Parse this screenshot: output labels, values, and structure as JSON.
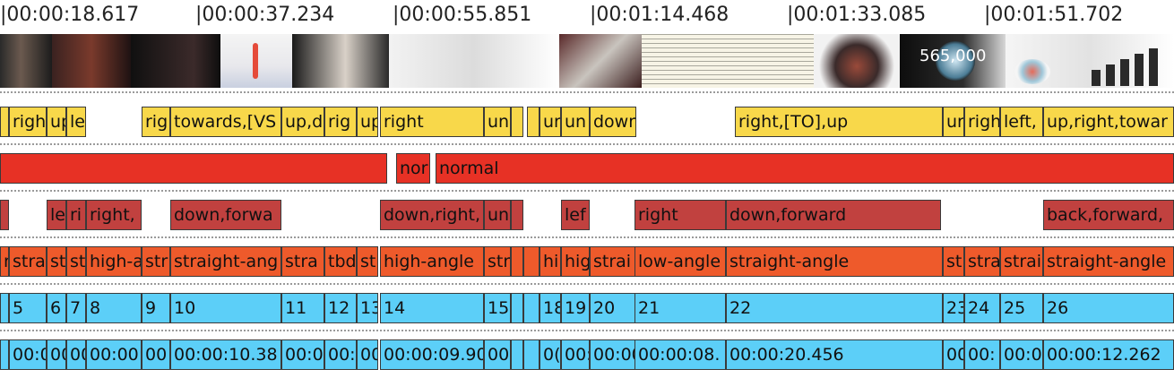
{
  "ruler": {
    "ticks": [
      "|00:00:18.617",
      "|00:00:37.234",
      "|00:00:55.851",
      "|00:01:14.468",
      "|00:01:33.085",
      "|00:01:51.702"
    ]
  },
  "thumbnails": {
    "overlay_text": "565,000",
    "frames": [
      "man-speaking-closeup",
      "audience-in-dark-room",
      "thermometer-graphic",
      "speaker-at-podium",
      "united-nations-document",
      "crowd-photo",
      "newspaper-article",
      "dark-sphere-texture",
      "globe-number-565000",
      "blue-earth-icon",
      "co2-bar-chart"
    ]
  },
  "tracks": [
    {
      "id": "direction",
      "color": "#f8d84a",
      "clips": [
        "",
        "righ",
        "up",
        "le",
        "rig",
        "towards,[VS",
        "up,d",
        "rig",
        "up",
        "right",
        "un",
        "",
        "",
        "ur",
        "un",
        "down",
        "right,[TO],up",
        "ur",
        "righ",
        "left,",
        "up,right,towar"
      ]
    },
    {
      "id": "speed",
      "color": "#e73125",
      "clips": [
        "",
        "nor",
        "normal"
      ]
    },
    {
      "id": "movement",
      "color": "#c1413f",
      "clips": [
        "",
        "le",
        "ri",
        "right,",
        "down,forwa",
        "down,right,",
        "un",
        "",
        "lef",
        "right",
        "down,forward",
        "back,forward,"
      ]
    },
    {
      "id": "angle",
      "color": "#ee5a2b",
      "clips": [
        "r",
        "stra",
        "st",
        "st",
        "high-a",
        "str",
        "straight-ang",
        "stra",
        "tbd",
        "st",
        "high-angle",
        "str",
        "",
        "",
        "hi",
        "hig",
        "strai",
        "low-angle",
        "straight-angle",
        "st",
        "stra",
        "strai",
        "straight-angle"
      ]
    },
    {
      "id": "shot-number",
      "color": "#5ccff8",
      "clips": [
        "",
        "5",
        "6",
        "7",
        "8",
        "9",
        "10",
        "11",
        "12",
        "13",
        "14",
        "15",
        "",
        "",
        "18",
        "19",
        "20",
        "21",
        "22",
        "23",
        "24",
        "25",
        "26"
      ]
    },
    {
      "id": "duration",
      "color": "#5ccff8",
      "clips": [
        "",
        "00:0",
        "00",
        "00",
        "00:00:",
        "00",
        "00:00:10.38",
        "00:0",
        "00:",
        "00",
        "00:00:09.90",
        "00",
        "",
        "",
        "0(",
        "00:",
        "00:00",
        "00:00:08.",
        "00:00:20.456",
        "00",
        "00:",
        "00:0",
        "00:00:12.262"
      ]
    }
  ]
}
